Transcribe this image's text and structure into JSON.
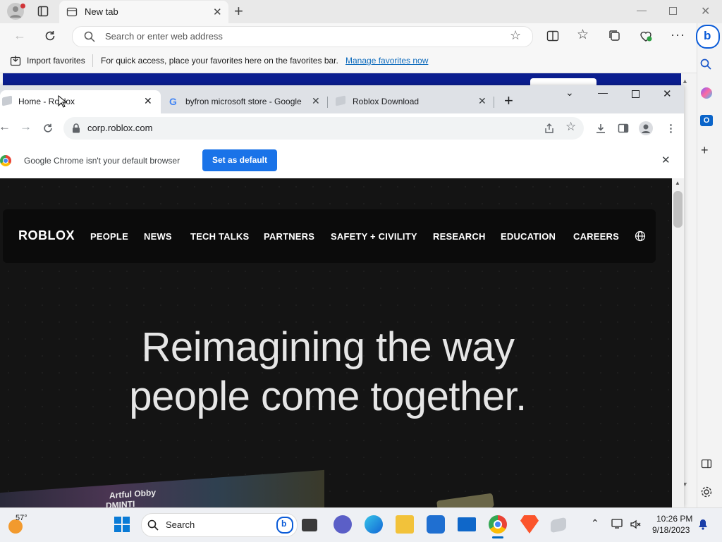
{
  "edge": {
    "tab_title": "New tab",
    "address_placeholder": "Search or enter web address",
    "favbar": {
      "import_label": "Import favorites",
      "hint": "For quick access, place your favorites here on the favorites bar.",
      "manage_link": "Manage favorites now"
    }
  },
  "chrome": {
    "tabs": [
      {
        "title": "Home - Roblox"
      },
      {
        "title": "byfron microsoft store - Google"
      },
      {
        "title": "Roblox Download"
      }
    ],
    "url": "corp.roblox.com",
    "infobar": {
      "message": "Google Chrome isn't your default browser",
      "button": "Set as default"
    }
  },
  "site": {
    "logo": "ROBLOX",
    "nav": [
      "PEOPLE",
      "NEWS",
      "TECH TALKS",
      "PARTNERS",
      "SAFETY + CIVILITY",
      "RESEARCH",
      "EDUCATION",
      "CAREERS"
    ],
    "hero_line1": "Reimagining the way",
    "hero_line2": "people come together.",
    "card_text": "Artful Obby",
    "card_text2": "DMINTI"
  },
  "taskbar": {
    "weather_temp": "57°",
    "search_label": "Search",
    "time": "10:26 PM",
    "date": "9/18/2023"
  },
  "colors": {
    "chrome_blue": "#1a73e8",
    "edge_link": "#0f6cbd",
    "page_bg": "#141414"
  }
}
